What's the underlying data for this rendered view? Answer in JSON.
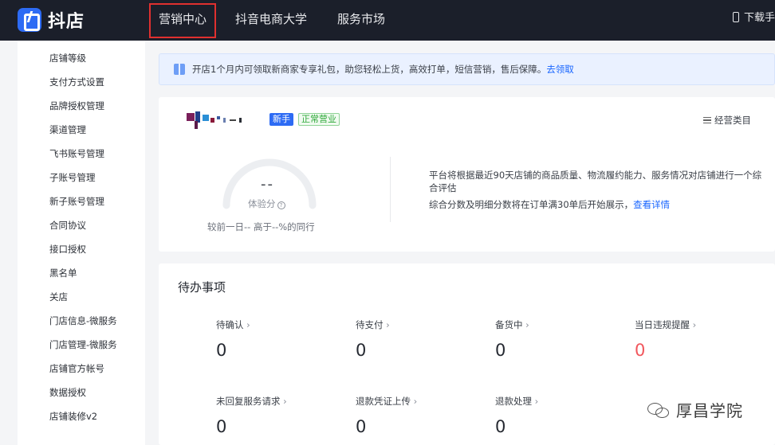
{
  "header": {
    "logo_text": "抖店",
    "nav": [
      "营销中心",
      "抖音电商大学",
      "服务市场"
    ],
    "download_label": "下载手"
  },
  "sidebar": {
    "items": [
      "店铺等级",
      "支付方式设置",
      "品牌授权管理",
      "渠道管理",
      "飞书账号管理",
      "子账号管理",
      "新子账号管理",
      "合同协议",
      "接口授权",
      "黑名单",
      "关店",
      "门店信息-微服务",
      "门店管理-微服务",
      "店铺官方帐号",
      "数据授权",
      "店铺装修v2"
    ]
  },
  "notice": {
    "text": "开店1个月内可领取新商家专享礼包，助您轻松上货，高效打单，短信营销，售后保障。",
    "link": "去领取"
  },
  "store": {
    "badge_new": "新手",
    "badge_status": "正常营业",
    "category_link": "经营类目",
    "score_value": "--",
    "score_label": "体验分",
    "compare_text": "较前一日--   高于--%的同行",
    "description": "平台将根据最近90天店铺的商品质量、物流履约能力、服务情况对店铺进行一个综合评估",
    "description2": "综合分数及明细分数将在订单满30单后开始展示，",
    "detail_link": "查看详情"
  },
  "todo": {
    "title": "待办事项",
    "items": [
      {
        "label": "待确认",
        "count": "0"
      },
      {
        "label": "待支付",
        "count": "0"
      },
      {
        "label": "备货中",
        "count": "0"
      },
      {
        "label": "当日违规提醒",
        "count": "0"
      },
      {
        "label": "未回复服务请求",
        "count": "0"
      },
      {
        "label": "退款凭证上传",
        "count": "0"
      },
      {
        "label": "退款处理",
        "count": "0"
      }
    ]
  },
  "colors": {
    "topbar": "#1b1f2a",
    "brand_blue": "#2d6bf4",
    "link_blue": "#1966ff",
    "highlight_red": "#e0302f",
    "warn_count": "#f1565c",
    "status_green": "#2fa83a"
  },
  "watermark": {
    "icon": "wechat-icon",
    "text": "厚昌学院"
  }
}
